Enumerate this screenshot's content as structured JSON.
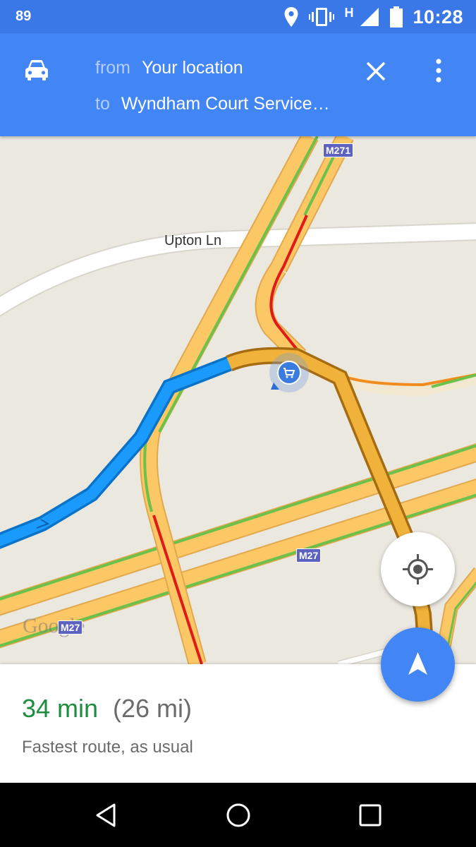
{
  "status_bar": {
    "notification_count": "89",
    "network_type": "H",
    "time": "10:28",
    "icons": [
      "location-icon",
      "vibrate-icon",
      "signal-icon",
      "battery-icon"
    ]
  },
  "header": {
    "mode_icon": "car-icon",
    "from_label": "from",
    "from_value": "Your location",
    "to_label": "to",
    "to_value": "Wyndham Court Service…",
    "colors": {
      "background": "#4285f4",
      "status_bar": "#3b78e7"
    }
  },
  "map": {
    "road_labels": {
      "upton_ln": "Upton Ln",
      "m271": "M271",
      "m27_mid": "M27",
      "m27_left": "M27"
    },
    "watermark": "Google",
    "colors": {
      "route": "#1a9bfc",
      "traffic_slow": "#f28b1e",
      "traffic_heavy": "#e01919",
      "traffic_free": "#6bc14a",
      "motorway": "#fcc865"
    }
  },
  "route_summary": {
    "duration": "34 min",
    "distance": "(26 mi)",
    "description": "Fastest route, as usual"
  }
}
